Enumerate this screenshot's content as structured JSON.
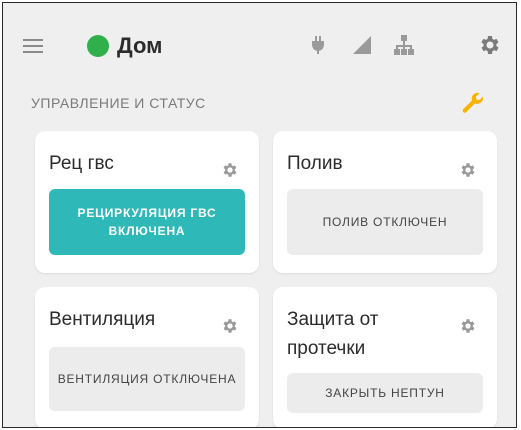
{
  "header": {
    "title": "Дом",
    "status_color": "#2fb04a",
    "icons": [
      "menu-icon",
      "plug-icon",
      "signal-icon",
      "network-icon",
      "settings-icon"
    ]
  },
  "section": {
    "title": "УПРАВЛЕНИЕ И СТАТУС",
    "tool_icon": "wrench-icon",
    "tool_color": "#f4b400"
  },
  "cards": [
    {
      "title": "Рец гвс",
      "button": "РЕЦИРКУЛЯЦИЯ ГВС ВКЛЮЧЕНА",
      "state": "on"
    },
    {
      "title": "Полив",
      "button": "ПОЛИВ ОТКЛЮЧЕН",
      "state": "off"
    },
    {
      "title": "Вентиляция",
      "button": "ВЕНТИЛЯЦИЯ ОТКЛЮЧЕНА",
      "state": "off"
    },
    {
      "title": "Защита от протечки",
      "button": "ЗАКРЫТЬ НЕПТУН",
      "state": "off"
    }
  ],
  "colors": {
    "accent": "#2fb8b8",
    "background": "#efefef"
  }
}
